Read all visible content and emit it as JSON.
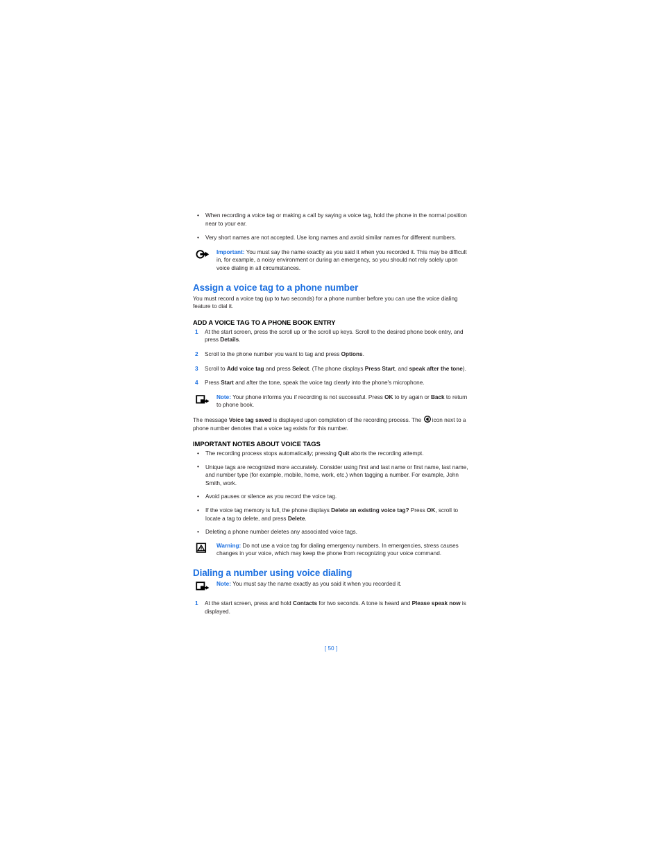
{
  "document": {
    "page_number_label": "[ 50 ]",
    "accent_color": "#1b6fe0",
    "text_color": "#231f20"
  },
  "intro_bullets": [
    {
      "id": "bullet-hold-phone",
      "text": "When recording a voice tag or making a call by saying a voice tag, hold the phone in the normal position near to your ear."
    },
    {
      "id": "bullet-short-names",
      "text": "Very short names are not accepted. Use long names and avoid similar names for different numbers."
    }
  ],
  "important_callout": {
    "icon": "important-hand-arrow-icon",
    "label": "Important:",
    "text": "You must say the name exactly as you said it when you recorded it. This may be difficult in, for example, a noisy environment or during an emergency, so you should not rely solely upon voice dialing in all circumstances."
  },
  "assign_section": {
    "heading": "Assign a voice tag to a phone number",
    "intro": "You must record a voice tag (up to two seconds) for a phone number before you can use the voice dialing feature to dial it.",
    "subheading": "ADD A VOICE TAG TO A PHONE BOOK ENTRY",
    "steps": [
      {
        "number": "1",
        "parts": [
          {
            "t": "At the start screen, press the scroll up or the scroll up keys. Scroll to the desired phone book entry, and press ",
            "b": false
          },
          {
            "t": "Details",
            "b": true
          },
          {
            "t": ".",
            "b": false
          }
        ]
      },
      {
        "number": "2",
        "parts": [
          {
            "t": "Scroll to the phone number you want to tag and press ",
            "b": false
          },
          {
            "t": "Options",
            "b": true
          },
          {
            "t": ".",
            "b": false
          }
        ]
      },
      {
        "number": "3",
        "parts": [
          {
            "t": "Scroll to ",
            "b": false
          },
          {
            "t": "Add voice tag",
            "b": true
          },
          {
            "t": " and press ",
            "b": false
          },
          {
            "t": "Select",
            "b": true
          },
          {
            "t": ". (The phone displays ",
            "b": false
          },
          {
            "t": "Press Start",
            "b": true
          },
          {
            "t": ", and ",
            "b": false
          },
          {
            "t": "speak after the tone",
            "b": true
          },
          {
            "t": ").",
            "b": false
          }
        ]
      },
      {
        "number": "4",
        "parts": [
          {
            "t": "Press ",
            "b": false
          },
          {
            "t": "Start",
            "b": true
          },
          {
            "t": " and after the tone, speak the voice tag clearly into the phone's microphone.",
            "b": false
          }
        ]
      }
    ],
    "note_callout": {
      "icon": "note-square-arrow-icon",
      "label": "Note:",
      "parts": [
        {
          "t": "Your phone informs you if recording is not successful. Press ",
          "b": false
        },
        {
          "t": "OK",
          "b": true
        },
        {
          "t": " to try again or ",
          "b": false
        },
        {
          "t": "Back",
          "b": true
        },
        {
          "t": " to return to phone book.",
          "b": false
        }
      ]
    },
    "closing_paragraph": {
      "parts": [
        {
          "t": "The message ",
          "b": false
        },
        {
          "t": "Voice tag saved",
          "b": true
        },
        {
          "t": " is displayed upon completion of the recording process. The ",
          "b": false
        },
        {
          "t": "__ICON__",
          "b": false
        },
        {
          "t": " icon next to a phone number denotes that a voice tag exists for this number.",
          "b": false
        }
      ],
      "inline_icon": "voice-tag-icon"
    }
  },
  "notes_section": {
    "subheading": "IMPORTANT NOTES ABOUT VOICE TAGS",
    "bullets": [
      {
        "id": "bullet-recording-stops",
        "parts": [
          {
            "t": "The recording process stops automatically; pressing ",
            "b": false
          },
          {
            "t": "Quit",
            "b": true
          },
          {
            "t": " aborts the recording attempt.",
            "b": false
          }
        ]
      },
      {
        "id": "bullet-unique-tags",
        "parts": [
          {
            "t": "Unique tags are recognized more accurately. Consider using first and last name or first name, last name, and number type (for example, mobile, home, work, etc.) when tagging a number. For example, John Smith, work.",
            "b": false
          }
        ]
      },
      {
        "id": "bullet-avoid-pauses",
        "parts": [
          {
            "t": "Avoid pauses or silence as you record the voice tag.",
            "b": false
          }
        ]
      },
      {
        "id": "bullet-memory-full",
        "parts": [
          {
            "t": "If the voice tag memory is full, the phone displays ",
            "b": false
          },
          {
            "t": "Delete an existing voice tag?",
            "b": true
          },
          {
            "t": " Press ",
            "b": false
          },
          {
            "t": "OK",
            "b": true
          },
          {
            "t": ", scroll to locate a tag to delete, and press ",
            "b": false
          },
          {
            "t": "Delete",
            "b": true
          },
          {
            "t": ".",
            "b": false
          }
        ]
      },
      {
        "id": "bullet-deleting-number",
        "parts": [
          {
            "t": "Deleting a phone number deletes any associated voice tags.",
            "b": false
          }
        ]
      }
    ],
    "warning_callout": {
      "icon": "warning-triangle-icon",
      "label": "Warning:",
      "text": "Do not use a voice tag for dialing emergency numbers. In emergencies, stress causes changes in your voice, which may keep the phone from recognizing your voice command."
    }
  },
  "dialing_section": {
    "heading": "Dialing a number using voice dialing",
    "note_callout": {
      "icon": "note-square-arrow-icon",
      "label": "Note:",
      "text": "You must say the name exactly as you said it when you recorded it."
    },
    "steps": [
      {
        "number": "1",
        "parts": [
          {
            "t": "At the start screen, press and hold ",
            "b": false
          },
          {
            "t": "Contacts",
            "b": true
          },
          {
            "t": " for two seconds. A tone is heard and ",
            "b": false
          },
          {
            "t": "Please speak now",
            "b": true
          },
          {
            "t": " is displayed.",
            "b": false
          }
        ]
      }
    ]
  }
}
